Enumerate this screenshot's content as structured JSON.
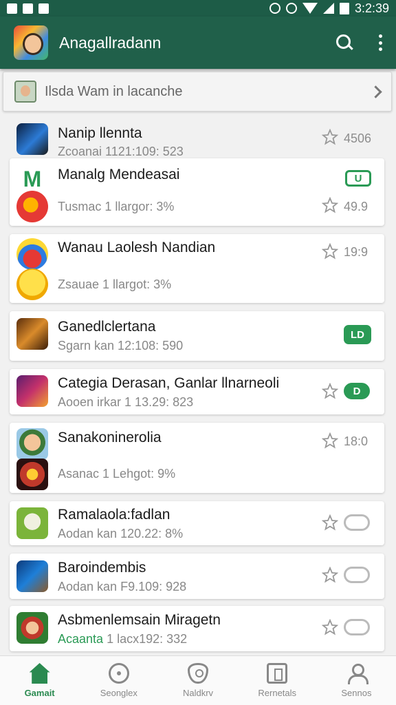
{
  "status_bar": {
    "time": "3:2:39"
  },
  "app_bar": {
    "title": "Anagallradann"
  },
  "banner": {
    "text": "Ilsda Wam in lacanche"
  },
  "rows": [
    {
      "title": "Nanip llennta",
      "subtitle": "Zcoanai 1121:109: 523",
      "rating": "4506",
      "control": "star"
    },
    {
      "title": "Manalg Mendeasai",
      "toggle": "U"
    },
    {
      "subtitle": "Tusmac 1 llargor: 3%",
      "rating": "49.9",
      "control": "star"
    },
    {
      "title": "Wanau Laolesh Nandian",
      "rating": "19:9",
      "control": "star"
    },
    {
      "subtitle": "Zsauae 1 llargot: 3%"
    },
    {
      "title": "Ganedlclertana",
      "subtitle": "Sgarn kan 12:108: 590",
      "toggle": "LD"
    },
    {
      "title": "Categia Derasan, Ganlar llnarneoli",
      "subtitle": "Aooen irkar 1 13.29: 823",
      "toggle": "D"
    },
    {
      "title": "Sanakoninerolia",
      "rating": "18:0",
      "control": "star"
    },
    {
      "subtitle": "Asanac 1 Lehgot: 9%"
    },
    {
      "title": "Ramalaola:fadlan",
      "subtitle": "Aodan kan 120.22: 8%",
      "toggle": ""
    },
    {
      "title": "Baroindembis",
      "subtitle": "Aodan kan F9.109: 928",
      "toggle": ""
    },
    {
      "title": "Asbmenlemsain Miragetn",
      "subtitle_prefix": "Acaanta",
      "subtitle": "1 lacx192: 332",
      "toggle": ""
    }
  ],
  "bottom_nav": [
    {
      "label": "Gamait",
      "icon": "home-icon",
      "active": true
    },
    {
      "label": "Seonglex",
      "icon": "compass-icon"
    },
    {
      "label": "Naldkrv",
      "icon": "shield-icon"
    },
    {
      "label": "Rernetals",
      "icon": "box-icon"
    },
    {
      "label": "Sennos",
      "icon": "users-icon"
    }
  ],
  "colors": {
    "appbar": "#20604a",
    "statusbar": "#1d5c47",
    "accent": "#2a9a55"
  }
}
